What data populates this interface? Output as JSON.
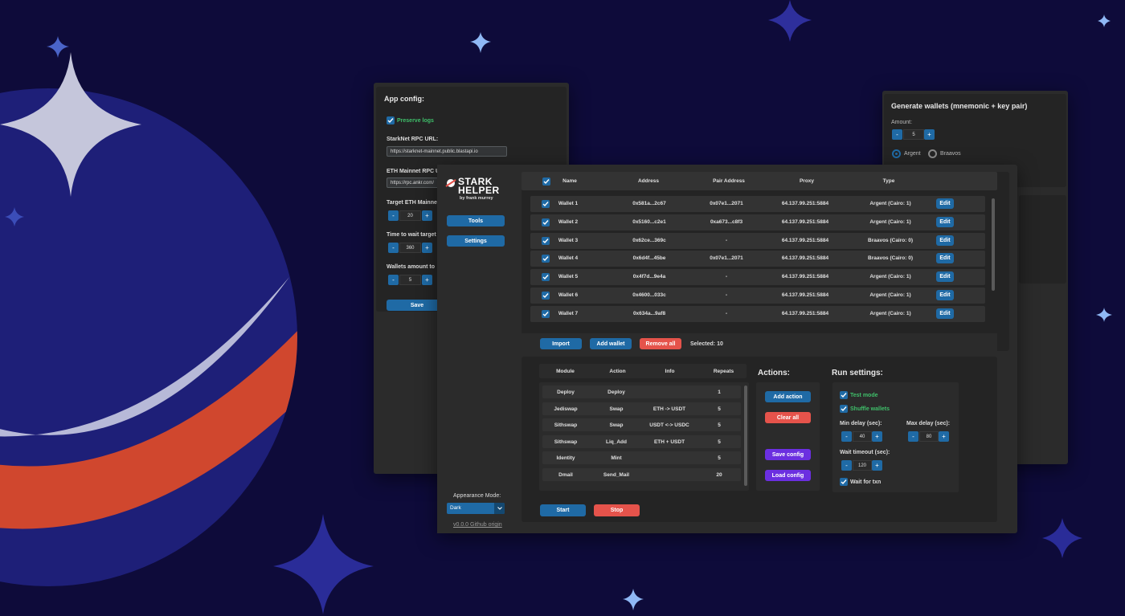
{
  "app_config": {
    "title": "App config:",
    "preserve_logs_label": "Preserve logs",
    "starknet_rpc_label": "StarkNet RPC URL:",
    "starknet_rpc_value": "https://starknet-mainnet.public.blastapi.io",
    "eth_rpc_label": "ETH Mainnet RPC U",
    "eth_rpc_value": "https://rpc.ankr.com/",
    "target_eth_label": "Target ETH Mainne",
    "target_eth_value": "20",
    "time_wait_label": "Time to wait target",
    "time_wait_value": "360",
    "wallets_amount_label": "Wallets amount to",
    "wallets_amount_value": "5",
    "save_label": "Save"
  },
  "generate": {
    "title": "Generate wallets (mnemonic + key pair)",
    "amount_label": "Amount:",
    "amount_value": "5",
    "radio_argent": "Argent",
    "radio_braavos": "Braavos"
  },
  "sidebar": {
    "logo_line1": "STARK",
    "logo_line2": "HELPER",
    "logo_sub": "by frank murrey",
    "tools_label": "Tools",
    "settings_label": "Settings",
    "appearance_label": "Appearance Mode:",
    "appearance_value": "Dark",
    "github_link": "v0.0.0 Github origin"
  },
  "wallets_table": {
    "headers": [
      "Name",
      "Address",
      "Pair Address",
      "Proxy",
      "Type"
    ],
    "edit_label": "Edit",
    "rows": [
      {
        "name": "Wallet 1",
        "address": "0x581a...2c67",
        "pair": "0x07e1...2071",
        "proxy": "64.137.99.251:5884",
        "type": "Argent (Cairo: 1)"
      },
      {
        "name": "Wallet 2",
        "address": "0x5160...c2e1",
        "pair": "0xa673...c8f3",
        "proxy": "64.137.99.251:5884",
        "type": "Argent (Cairo: 1)"
      },
      {
        "name": "Wallet 3",
        "address": "0x62ce...369c",
        "pair": "-",
        "proxy": "64.137.99.251:5884",
        "type": "Braavos (Cairo: 0)"
      },
      {
        "name": "Wallet 4",
        "address": "0x6d4f...45be",
        "pair": "0x07e1...2071",
        "proxy": "64.137.99.251:5884",
        "type": "Braavos (Cairo: 0)"
      },
      {
        "name": "Wallet 5",
        "address": "0x4f7d...9e4a",
        "pair": "-",
        "proxy": "64.137.99.251:5884",
        "type": "Argent (Cairo: 1)"
      },
      {
        "name": "Wallet 6",
        "address": "0x4600...033c",
        "pair": "-",
        "proxy": "64.137.99.251:5884",
        "type": "Argent (Cairo: 1)"
      },
      {
        "name": "Wallet 7",
        "address": "0x634a...9af8",
        "pair": "-",
        "proxy": "64.137.99.251:5884",
        "type": "Argent (Cairo: 1)"
      }
    ],
    "import_label": "Import",
    "add_wallet_label": "Add wallet",
    "remove_all_label": "Remove all",
    "selected_text": "Selected: 10"
  },
  "actions_table": {
    "headers": [
      "Module",
      "Action",
      "Info",
      "Repeats"
    ],
    "rows": [
      {
        "module": "Deploy",
        "action": "Deploy",
        "info": "",
        "repeats": "1"
      },
      {
        "module": "Jediswap",
        "action": "Swap",
        "info": "ETH -> USDT",
        "repeats": "5"
      },
      {
        "module": "Sithswap",
        "action": "Swap",
        "info": "USDT <-> USDC",
        "repeats": "5"
      },
      {
        "module": "Sithswap",
        "action": "Liq_Add",
        "info": "ETH + USDT",
        "repeats": "5"
      },
      {
        "module": "Identity",
        "action": "Mint",
        "info": "",
        "repeats": "5"
      },
      {
        "module": "Dmail",
        "action": "Send_Mail",
        "info": "",
        "repeats": "20"
      }
    ]
  },
  "actions_panel": {
    "title": "Actions:",
    "add_action": "Add action",
    "clear_all": "Clear all",
    "save_config": "Save config",
    "load_config": "Load config"
  },
  "run_settings": {
    "title": "Run settings:",
    "test_mode": "Test mode",
    "shuffle_wallets": "Shuffle wallets",
    "min_delay_label": "Min delay (sec):",
    "min_delay_value": "40",
    "max_delay_label": "Max delay (sec):",
    "max_delay_value": "80",
    "wait_timeout_label": "Wait timeout (sec):",
    "wait_timeout_value": "120",
    "wait_for_txn": "Wait for txn"
  },
  "controls": {
    "start_label": "Start",
    "stop_label": "Stop",
    "minus": "-",
    "plus": "+"
  },
  "colors": {
    "background": "#0e0b3a",
    "accent_blue": "#1f6aa5",
    "danger_red": "#e5534b",
    "purple": "#6b2fe0",
    "green_text": "#3fbf6a"
  }
}
